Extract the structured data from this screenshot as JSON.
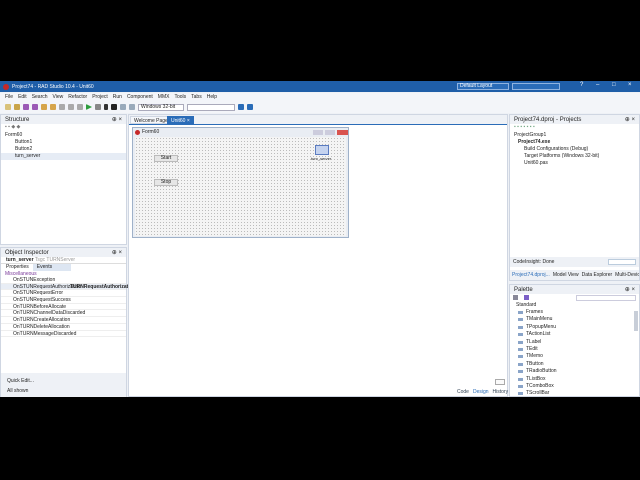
{
  "window": {
    "title": "Project74 - RAD Studio 10.4 - Unit60",
    "layout": "Default Layout"
  },
  "menu": [
    "File",
    "Edit",
    "Search",
    "View",
    "Refactor",
    "Project",
    "Run",
    "Component",
    "MMX",
    "Tools",
    "Tabs",
    "Help"
  ],
  "toolbar": {
    "platform": "Windows 32-bit"
  },
  "structure": {
    "title": "Structure",
    "items": [
      "Form60",
      "Button1",
      "Button2",
      "turn_server"
    ]
  },
  "inspector": {
    "title": "Object Inspector",
    "object": "turn_server",
    "object_type": "Tsgc TURNServer",
    "tabs": [
      "Properties",
      "Events"
    ],
    "category": "Miscellaneous",
    "events": [
      "OnSTUNException",
      "OnSTUNRequestAuthorization",
      "OnSTUNRequestError",
      "OnSTUNRequestSuccess",
      "OnTURNBeforeAllocate",
      "OnTURNChannelDataDiscarded",
      "OnTURNCreateAllocation",
      "OnTURNDeleteAllocation",
      "OnTURNMessageDiscarded"
    ],
    "selected_value": "TURNRequestAuthorization",
    "quick_edit": "Quick Edit...",
    "all_shown": "All shown"
  },
  "editor": {
    "tabs": [
      "Welcome Page",
      "Unit60"
    ],
    "form_caption": "Form60",
    "buttons": [
      "Start",
      "Stop"
    ],
    "component_label": "turn_server",
    "bottom_tabs": [
      "Code",
      "Design",
      "History"
    ]
  },
  "projects": {
    "title": "Project74.dproj - Projects",
    "items": [
      "ProjectGroup1",
      "Project74.exe",
      "Build Configurations (Debug)",
      "Target Platforms (Windows 32-bit)",
      "Unit60.pas"
    ],
    "status": "CodeInsight: Done",
    "tabs": [
      "Project74.dproj...",
      "Model View",
      "Data Explorer",
      "Multi-Device Pre..."
    ]
  },
  "palette": {
    "title": "Palette",
    "category": "Standard",
    "items": [
      "Frames",
      "TMainMenu",
      "TPopupMenu",
      "TActionList",
      "TLabel",
      "TEdit",
      "TMemo",
      "TButton",
      "TRadioButton",
      "TListBox",
      "TComboBox",
      "TScrollBar"
    ]
  }
}
